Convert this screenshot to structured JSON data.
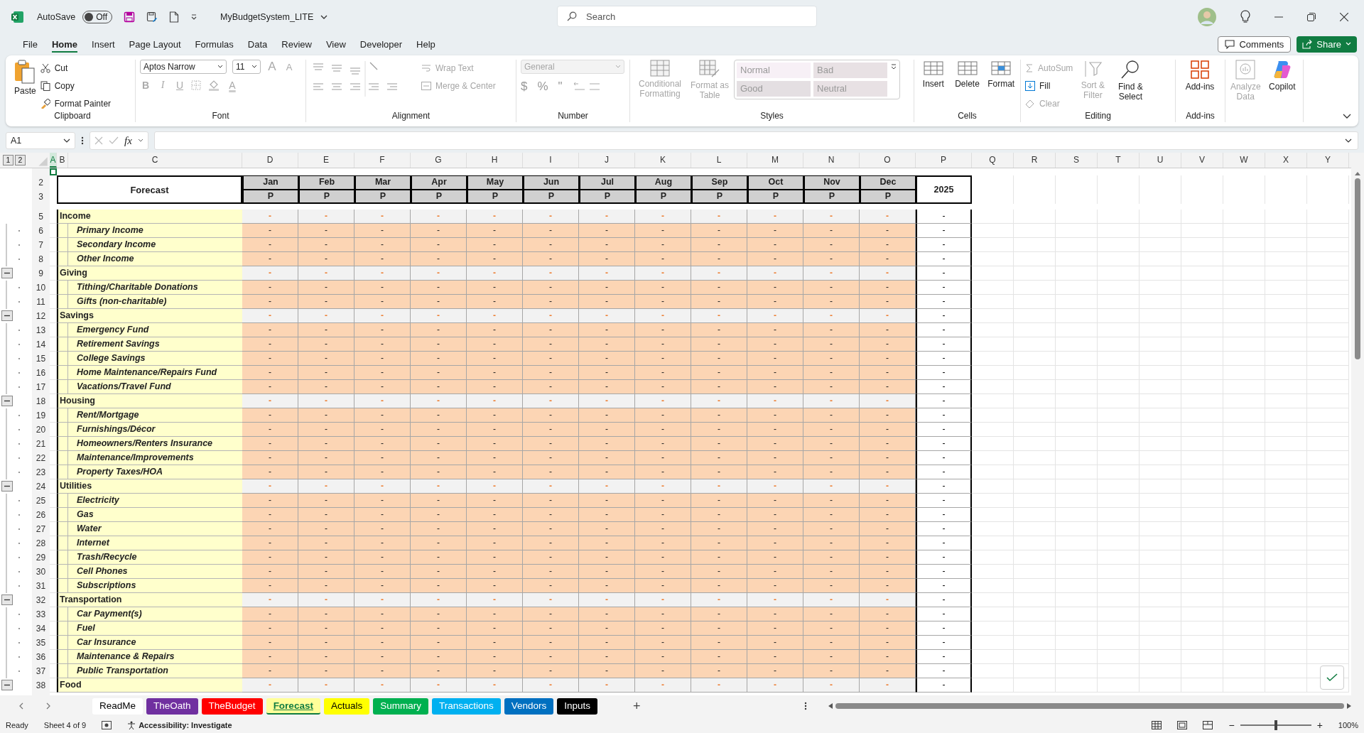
{
  "title_bar": {
    "autosave_label": "AutoSave",
    "autosave": {
      "label": "Off",
      "on": false
    },
    "file_name": "MyBudgetSystem_LITE",
    "search": {
      "placeholder": "Search"
    }
  },
  "menu_tabs": [
    {
      "label": "File",
      "selected": false
    },
    {
      "label": "Home",
      "selected": true
    },
    {
      "label": "Insert",
      "selected": false
    },
    {
      "label": "Page Layout",
      "selected": false
    },
    {
      "label": "Formulas",
      "selected": false
    },
    {
      "label": "Data",
      "selected": false
    },
    {
      "label": "Review",
      "selected": false
    },
    {
      "label": "View",
      "selected": false
    },
    {
      "label": "Developer",
      "selected": false
    },
    {
      "label": "Help",
      "selected": false
    }
  ],
  "actions": {
    "comments": "Comments",
    "share": "Share"
  },
  "ribbon": {
    "clipboard": {
      "title": "Clipboard",
      "paste": "Paste",
      "cut": "Cut",
      "copy": "Copy",
      "format_painter": "Format Painter"
    },
    "font": {
      "title": "Font",
      "family": "Aptos Narrow",
      "size": "11",
      "grow": {
        "label": "A",
        "disabled": true
      },
      "shrink": {
        "label": "A",
        "disabled": true
      },
      "bold": {
        "label": "B",
        "disabled": true
      },
      "italic": {
        "label": "I",
        "disabled": true
      },
      "underline": {
        "label": "U",
        "disabled": true
      },
      "font_color": {
        "label": "A",
        "disabled": true
      }
    },
    "alignment": {
      "title": "Alignment",
      "wrap": {
        "label": "Wrap Text",
        "disabled": true
      },
      "merge": {
        "label": "Merge & Center",
        "disabled": true
      }
    },
    "number": {
      "title": "Number",
      "format": {
        "label": "General",
        "disabled": true
      },
      "currency": "$",
      "percent": "%",
      "comma": "\""
    },
    "styles": {
      "title": "Styles",
      "conditional": {
        "label": "Conditional Formatting",
        "disabled": true
      },
      "table": {
        "label": "Format as Table",
        "disabled": true
      },
      "cells": [
        {
          "label": "Normal",
          "kind": "normal"
        },
        {
          "label": "Bad",
          "kind": "bad"
        },
        {
          "label": "Good",
          "kind": "good"
        },
        {
          "label": "Neutral",
          "kind": "neutral"
        }
      ]
    },
    "cells": {
      "title": "Cells",
      "items": [
        {
          "label": "Insert",
          "disabled": false
        },
        {
          "label": "Delete",
          "disabled": false
        },
        {
          "label": "Format",
          "disabled": false
        }
      ]
    },
    "editing": {
      "title": "Editing",
      "autosum": {
        "label": "AutoSum",
        "disabled": true
      },
      "fill": {
        "label": "Fill",
        "disabled": false
      },
      "clear": {
        "label": "Clear",
        "disabled": true
      },
      "sort": {
        "label": "Sort & Filter",
        "disabled": true
      },
      "find": {
        "label": "Find & Select",
        "disabled": false
      }
    },
    "addins": {
      "title": "Add-ins",
      "addins": {
        "label": "Add-ins",
        "disabled": false
      }
    },
    "extra": {
      "analyze": {
        "label": "Analyze Data",
        "disabled": true
      },
      "copilot": {
        "label": "Copilot",
        "disabled": false
      }
    }
  },
  "formula_bar": {
    "name_box": "A1",
    "fx": "fx"
  },
  "outline_levels": [
    "1",
    "2"
  ],
  "column_headers": [
    "A",
    "B",
    "C",
    "D",
    "E",
    "F",
    "G",
    "H",
    "I",
    "J",
    "K",
    "L",
    "M",
    "N",
    "O",
    "P",
    "Q",
    "R",
    "S",
    "T",
    "U",
    "V",
    "W",
    "X",
    "Y"
  ],
  "forecast": {
    "title": "Forecast",
    "row_numbers": [
      "2",
      "3"
    ],
    "total_label": "2025",
    "months": [
      {
        "label": "Jan",
        "sub": "P"
      },
      {
        "label": "Feb",
        "sub": "P"
      },
      {
        "label": "Mar",
        "sub": "P"
      },
      {
        "label": "Apr",
        "sub": "P"
      },
      {
        "label": "May",
        "sub": "P"
      },
      {
        "label": "Jun",
        "sub": "P"
      },
      {
        "label": "Jul",
        "sub": "P"
      },
      {
        "label": "Aug",
        "sub": "P"
      },
      {
        "label": "Sep",
        "sub": "P"
      },
      {
        "label": "Oct",
        "sub": "P"
      },
      {
        "label": "Nov",
        "sub": "P"
      },
      {
        "label": "Dec",
        "sub": "P"
      }
    ]
  },
  "rows": [
    {
      "num": "5",
      "label": "Income",
      "kind": "group",
      "collapse": false,
      "values": [
        "-",
        "-",
        "-",
        "-",
        "-",
        "-",
        "-",
        "-",
        "-",
        "-",
        "-",
        "-",
        "-"
      ]
    },
    {
      "num": "6",
      "label": "Primary Income",
      "kind": "item",
      "values": [
        "-",
        "-",
        "-",
        "-",
        "-",
        "-",
        "-",
        "-",
        "-",
        "-",
        "-",
        "-",
        "-"
      ]
    },
    {
      "num": "7",
      "label": "Secondary Income",
      "kind": "item",
      "values": [
        "-",
        "-",
        "-",
        "-",
        "-",
        "-",
        "-",
        "-",
        "-",
        "-",
        "-",
        "-",
        "-"
      ]
    },
    {
      "num": "8",
      "label": "Other Income",
      "kind": "item",
      "values": [
        "-",
        "-",
        "-",
        "-",
        "-",
        "-",
        "-",
        "-",
        "-",
        "-",
        "-",
        "-",
        "-"
      ]
    },
    {
      "num": "9",
      "label": "Giving",
      "kind": "group",
      "collapse": true,
      "values": [
        "-",
        "-",
        "-",
        "-",
        "-",
        "-",
        "-",
        "-",
        "-",
        "-",
        "-",
        "-",
        "-"
      ]
    },
    {
      "num": "10",
      "label": "Tithing/Charitable Donations",
      "kind": "item",
      "values": [
        "-",
        "-",
        "-",
        "-",
        "-",
        "-",
        "-",
        "-",
        "-",
        "-",
        "-",
        "-",
        "-"
      ]
    },
    {
      "num": "11",
      "label": "Gifts (non-charitable)",
      "kind": "item",
      "values": [
        "-",
        "-",
        "-",
        "-",
        "-",
        "-",
        "-",
        "-",
        "-",
        "-",
        "-",
        "-",
        "-"
      ]
    },
    {
      "num": "12",
      "label": "Savings",
      "kind": "group",
      "collapse": true,
      "values": [
        "-",
        "-",
        "-",
        "-",
        "-",
        "-",
        "-",
        "-",
        "-",
        "-",
        "-",
        "-",
        "-"
      ]
    },
    {
      "num": "13",
      "label": "Emergency Fund",
      "kind": "item",
      "values": [
        "-",
        "-",
        "-",
        "-",
        "-",
        "-",
        "-",
        "-",
        "-",
        "-",
        "-",
        "-",
        "-"
      ]
    },
    {
      "num": "14",
      "label": "Retirement Savings",
      "kind": "item",
      "values": [
        "-",
        "-",
        "-",
        "-",
        "-",
        "-",
        "-",
        "-",
        "-",
        "-",
        "-",
        "-",
        "-"
      ]
    },
    {
      "num": "15",
      "label": "College Savings",
      "kind": "item",
      "values": [
        "-",
        "-",
        "-",
        "-",
        "-",
        "-",
        "-",
        "-",
        "-",
        "-",
        "-",
        "-",
        "-"
      ]
    },
    {
      "num": "16",
      "label": "Home Maintenance/Repairs Fund",
      "kind": "item",
      "values": [
        "-",
        "-",
        "-",
        "-",
        "-",
        "-",
        "-",
        "-",
        "-",
        "-",
        "-",
        "-",
        "-"
      ]
    },
    {
      "num": "17",
      "label": "Vacations/Travel Fund",
      "kind": "item",
      "values": [
        "-",
        "-",
        "-",
        "-",
        "-",
        "-",
        "-",
        "-",
        "-",
        "-",
        "-",
        "-",
        "-"
      ]
    },
    {
      "num": "18",
      "label": "Housing",
      "kind": "group",
      "collapse": true,
      "values": [
        "-",
        "-",
        "-",
        "-",
        "-",
        "-",
        "-",
        "-",
        "-",
        "-",
        "-",
        "-",
        "-"
      ]
    },
    {
      "num": "19",
      "label": "Rent/Mortgage",
      "kind": "item",
      "values": [
        "-",
        "-",
        "-",
        "-",
        "-",
        "-",
        "-",
        "-",
        "-",
        "-",
        "-",
        "-",
        "-"
      ]
    },
    {
      "num": "20",
      "label": "Furnishings/Décor",
      "kind": "item",
      "values": [
        "-",
        "-",
        "-",
        "-",
        "-",
        "-",
        "-",
        "-",
        "-",
        "-",
        "-",
        "-",
        "-"
      ]
    },
    {
      "num": "21",
      "label": "Homeowners/Renters Insurance",
      "kind": "item",
      "values": [
        "-",
        "-",
        "-",
        "-",
        "-",
        "-",
        "-",
        "-",
        "-",
        "-",
        "-",
        "-",
        "-"
      ]
    },
    {
      "num": "22",
      "label": "Maintenance/Improvements",
      "kind": "item",
      "values": [
        "-",
        "-",
        "-",
        "-",
        "-",
        "-",
        "-",
        "-",
        "-",
        "-",
        "-",
        "-",
        "-"
      ]
    },
    {
      "num": "23",
      "label": "Property Taxes/HOA",
      "kind": "item",
      "values": [
        "-",
        "-",
        "-",
        "-",
        "-",
        "-",
        "-",
        "-",
        "-",
        "-",
        "-",
        "-",
        "-"
      ]
    },
    {
      "num": "24",
      "label": "Utilities",
      "kind": "group",
      "collapse": true,
      "values": [
        "-",
        "-",
        "-",
        "-",
        "-",
        "-",
        "-",
        "-",
        "-",
        "-",
        "-",
        "-",
        "-"
      ]
    },
    {
      "num": "25",
      "label": "Electricity",
      "kind": "item",
      "values": [
        "-",
        "-",
        "-",
        "-",
        "-",
        "-",
        "-",
        "-",
        "-",
        "-",
        "-",
        "-",
        "-"
      ]
    },
    {
      "num": "26",
      "label": "Gas",
      "kind": "item",
      "values": [
        "-",
        "-",
        "-",
        "-",
        "-",
        "-",
        "-",
        "-",
        "-",
        "-",
        "-",
        "-",
        "-"
      ]
    },
    {
      "num": "27",
      "label": "Water",
      "kind": "item",
      "values": [
        "-",
        "-",
        "-",
        "-",
        "-",
        "-",
        "-",
        "-",
        "-",
        "-",
        "-",
        "-",
        "-"
      ]
    },
    {
      "num": "28",
      "label": "Internet",
      "kind": "item",
      "values": [
        "-",
        "-",
        "-",
        "-",
        "-",
        "-",
        "-",
        "-",
        "-",
        "-",
        "-",
        "-",
        "-"
      ]
    },
    {
      "num": "29",
      "label": "Trash/Recycle",
      "kind": "item",
      "values": [
        "-",
        "-",
        "-",
        "-",
        "-",
        "-",
        "-",
        "-",
        "-",
        "-",
        "-",
        "-",
        "-"
      ]
    },
    {
      "num": "30",
      "label": "Cell Phones",
      "kind": "item",
      "values": [
        "-",
        "-",
        "-",
        "-",
        "-",
        "-",
        "-",
        "-",
        "-",
        "-",
        "-",
        "-",
        "-"
      ]
    },
    {
      "num": "31",
      "label": "Subscriptions",
      "kind": "item",
      "values": [
        "-",
        "-",
        "-",
        "-",
        "-",
        "-",
        "-",
        "-",
        "-",
        "-",
        "-",
        "-",
        "-"
      ]
    },
    {
      "num": "32",
      "label": "Transportation",
      "kind": "group",
      "collapse": true,
      "values": [
        "-",
        "-",
        "-",
        "-",
        "-",
        "-",
        "-",
        "-",
        "-",
        "-",
        "-",
        "-",
        "-"
      ]
    },
    {
      "num": "33",
      "label": "Car Payment(s)",
      "kind": "item",
      "values": [
        "-",
        "-",
        "-",
        "-",
        "-",
        "-",
        "-",
        "-",
        "-",
        "-",
        "-",
        "-",
        "-"
      ]
    },
    {
      "num": "34",
      "label": "Fuel",
      "kind": "item",
      "values": [
        "-",
        "-",
        "-",
        "-",
        "-",
        "-",
        "-",
        "-",
        "-",
        "-",
        "-",
        "-",
        "-"
      ]
    },
    {
      "num": "35",
      "label": "Car Insurance",
      "kind": "item",
      "values": [
        "-",
        "-",
        "-",
        "-",
        "-",
        "-",
        "-",
        "-",
        "-",
        "-",
        "-",
        "-",
        "-"
      ]
    },
    {
      "num": "36",
      "label": "Maintenance & Repairs",
      "kind": "item",
      "values": [
        "-",
        "-",
        "-",
        "-",
        "-",
        "-",
        "-",
        "-",
        "-",
        "-",
        "-",
        "-",
        "-"
      ]
    },
    {
      "num": "37",
      "label": "Public Transportation",
      "kind": "item",
      "values": [
        "-",
        "-",
        "-",
        "-",
        "-",
        "-",
        "-",
        "-",
        "-",
        "-",
        "-",
        "-",
        "-"
      ]
    },
    {
      "num": "38",
      "label": "Food",
      "kind": "group",
      "collapse": true,
      "values": [
        "-",
        "-",
        "-",
        "-",
        "-",
        "-",
        "-",
        "-",
        "-",
        "-",
        "-",
        "-",
        "-"
      ]
    }
  ],
  "sheet_tabs": [
    {
      "label": "ReadMe",
      "color": "#ffffff",
      "selected": false
    },
    {
      "label": "TheOath",
      "color": "#7030a0",
      "selected": false
    },
    {
      "label": "TheBudget",
      "color": "#ff0000",
      "selected": false
    },
    {
      "label": "Forecast",
      "color": "#ffff99",
      "selected": true
    },
    {
      "label": "Actuals",
      "color": "#ffff00",
      "selected": false
    },
    {
      "label": "Summary",
      "color": "#00b050",
      "selected": false
    },
    {
      "label": "Transactions",
      "color": "#00b0f0",
      "selected": false
    },
    {
      "label": "Vendors",
      "color": "#0070c0",
      "selected": false
    },
    {
      "label": "Inputs",
      "color": "#000000",
      "selected": false
    }
  ],
  "add_sheet": "+",
  "status_bar": {
    "ready": "Ready",
    "sheet": "Sheet 4 of 9",
    "accessibility": "Accessibility: Investigate",
    "zoom_out": "−",
    "zoom_in": "+",
    "zoom": {
      "level": 0.5,
      "label": "100%"
    }
  }
}
